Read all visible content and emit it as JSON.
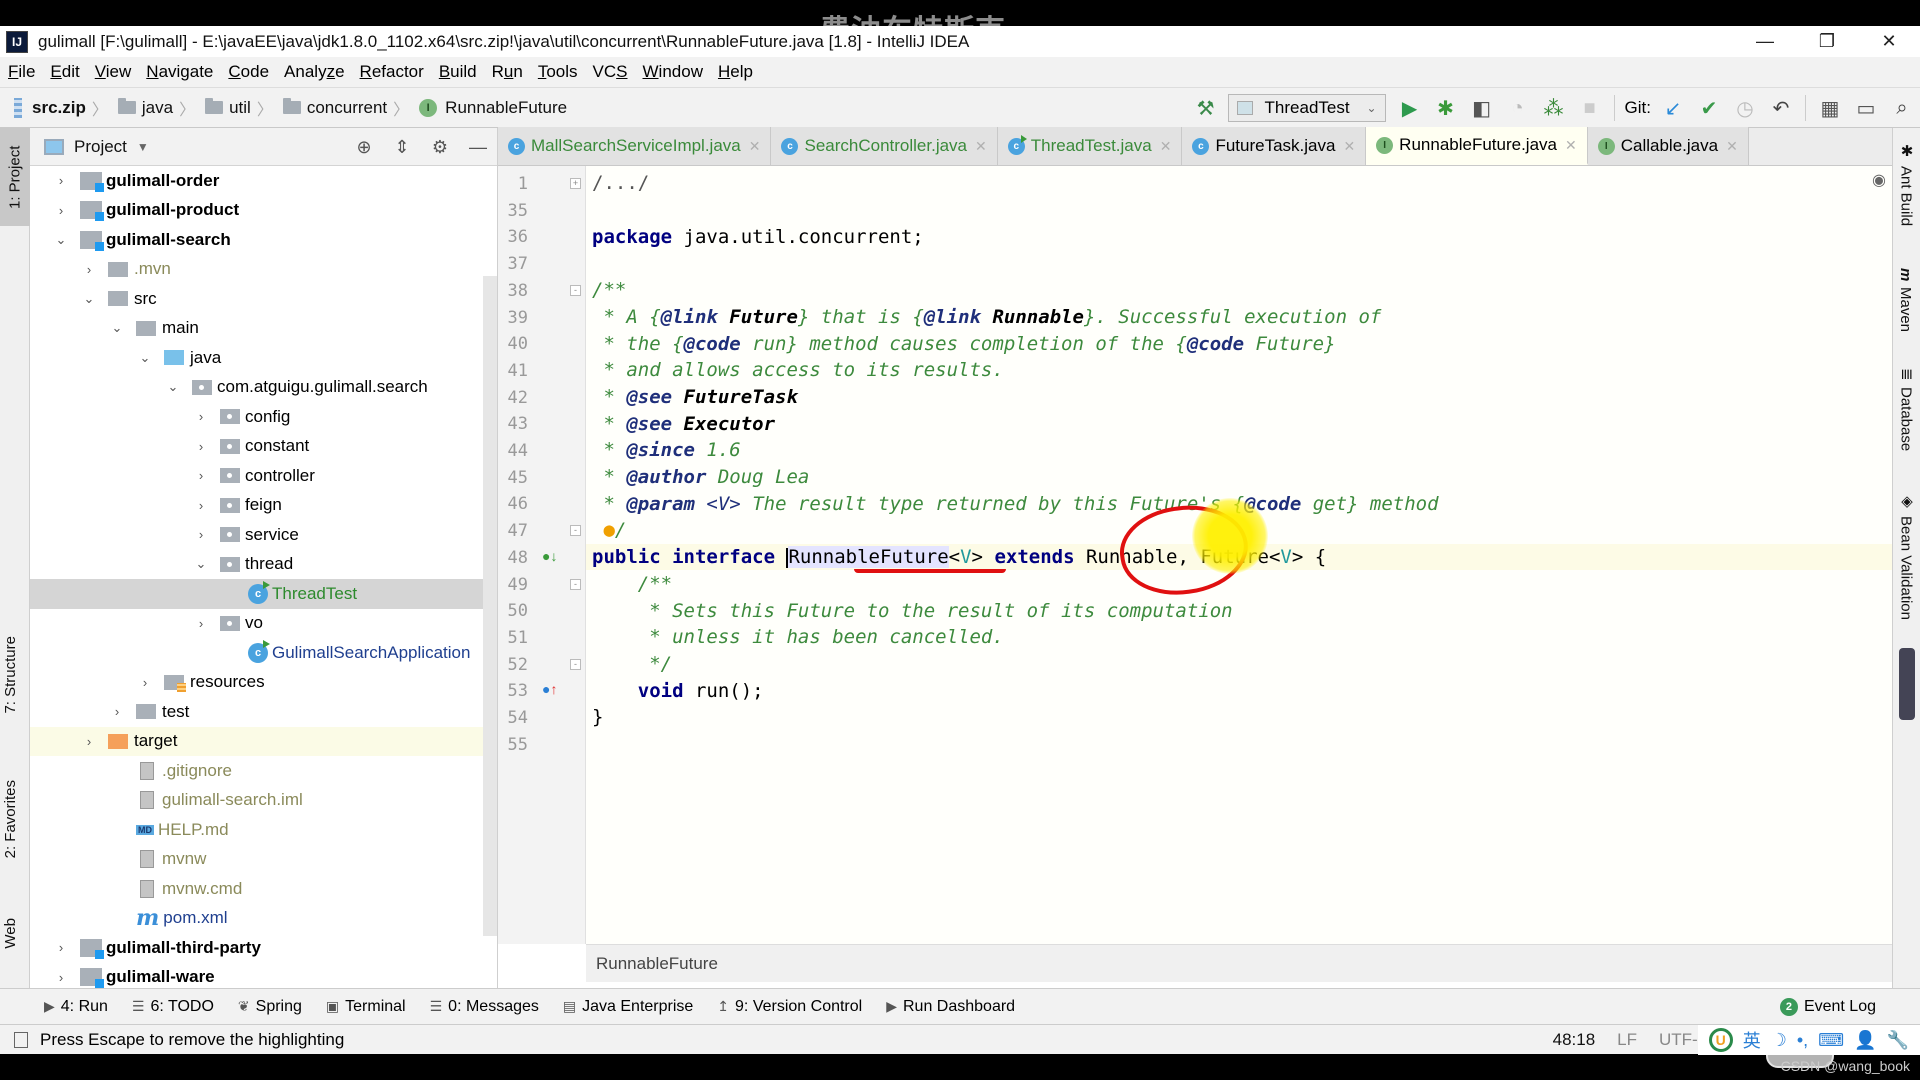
{
  "watermark_top": "费油车特斯克",
  "window": {
    "title": "gulimall [F:\\gulimall] - E:\\javaEE\\java\\jdk1.8.0_1102.x64\\src.zip!\\java\\util\\concurrent\\RunnableFuture.java [1.8] - IntelliJ IDEA",
    "logo": "IJ",
    "minimize": "—",
    "restore": "❐",
    "close": "✕"
  },
  "menu": [
    "File",
    "Edit",
    "View",
    "Navigate",
    "Code",
    "Analyze",
    "Refactor",
    "Build",
    "Run",
    "Tools",
    "VCS",
    "Window",
    "Help"
  ],
  "menu_mnemonics": [
    "F",
    "E",
    "V",
    "N",
    "C",
    "z",
    "R",
    "B",
    "u",
    "T",
    "S",
    "W",
    "H"
  ],
  "navbar": {
    "crumbs": [
      "src.zip",
      "java",
      "util",
      "concurrent",
      "RunnableFuture"
    ],
    "run_config": "ThreadTest",
    "git_label": "Git:"
  },
  "left_strip": {
    "tabs": [
      "1: Project",
      "7: Structure",
      "2: Favorites",
      "Web"
    ]
  },
  "project_panel": {
    "title": "Project",
    "tree": [
      {
        "label": "gulimall-order",
        "type": "module",
        "depth": 0,
        "arrow": "›"
      },
      {
        "label": "gulimall-product",
        "type": "module",
        "depth": 0,
        "arrow": "›"
      },
      {
        "label": "gulimall-search",
        "type": "module",
        "depth": 0,
        "arrow": "⌄"
      },
      {
        "label": ".mvn",
        "type": "folder-muted",
        "depth": 1,
        "arrow": "›"
      },
      {
        "label": "src",
        "type": "folder",
        "depth": 1,
        "arrow": "⌄"
      },
      {
        "label": "main",
        "type": "folder",
        "depth": 2,
        "arrow": "⌄"
      },
      {
        "label": "java",
        "type": "folder-blue",
        "depth": 3,
        "arrow": "⌄"
      },
      {
        "label": "com.atguigu.gulimall.search",
        "type": "package",
        "depth": 4,
        "arrow": "⌄"
      },
      {
        "label": "config",
        "type": "package",
        "depth": 5,
        "arrow": "›"
      },
      {
        "label": "constant",
        "type": "package",
        "depth": 5,
        "arrow": "›"
      },
      {
        "label": "controller",
        "type": "package",
        "depth": 5,
        "arrow": "›"
      },
      {
        "label": "feign",
        "type": "package",
        "depth": 5,
        "arrow": "›"
      },
      {
        "label": "service",
        "type": "package",
        "depth": 5,
        "arrow": "›"
      },
      {
        "label": "thread",
        "type": "package",
        "depth": 5,
        "arrow": "⌄"
      },
      {
        "label": "ThreadTest",
        "type": "class-run",
        "depth": 6,
        "arrow": "",
        "selected": true
      },
      {
        "label": "vo",
        "type": "package",
        "depth": 5,
        "arrow": "›"
      },
      {
        "label": "GulimallSearchApplication",
        "type": "class-app",
        "depth": 6,
        "arrow": ""
      },
      {
        "label": "resources",
        "type": "folder-res",
        "depth": 3,
        "arrow": "›"
      },
      {
        "label": "test",
        "type": "folder",
        "depth": 2,
        "arrow": "›"
      },
      {
        "label": "target",
        "type": "folder-orange",
        "depth": 1,
        "arrow": "›",
        "highlight": true
      },
      {
        "label": ".gitignore",
        "type": "file",
        "depth": 2,
        "arrow": ""
      },
      {
        "label": "gulimall-search.iml",
        "type": "file",
        "depth": 2,
        "arrow": ""
      },
      {
        "label": "HELP.md",
        "type": "md",
        "depth": 2,
        "arrow": ""
      },
      {
        "label": "mvnw",
        "type": "file",
        "depth": 2,
        "arrow": ""
      },
      {
        "label": "mvnw.cmd",
        "type": "file",
        "depth": 2,
        "arrow": ""
      },
      {
        "label": "pom.xml",
        "type": "maven",
        "depth": 2,
        "arrow": ""
      },
      {
        "label": "gulimall-third-party",
        "type": "module",
        "depth": 0,
        "arrow": "›"
      },
      {
        "label": "gulimall-ware",
        "type": "module",
        "depth": 0,
        "arrow": "›"
      }
    ]
  },
  "editor": {
    "tabs": [
      {
        "label": "MallSearchServiceImpl.java",
        "icon": "c",
        "kind": "class",
        "green": true
      },
      {
        "label": "SearchController.java",
        "icon": "c",
        "kind": "class",
        "green": true
      },
      {
        "label": "ThreadTest.java",
        "icon": "c",
        "kind": "class-run",
        "green": true
      },
      {
        "label": "FutureTask.java",
        "icon": "c",
        "kind": "class"
      },
      {
        "label": "RunnableFuture.java",
        "icon": "I",
        "kind": "iface",
        "active": true
      },
      {
        "label": "Callable.java",
        "icon": "I",
        "kind": "iface"
      }
    ],
    "lines": [
      {
        "n": "1",
        "html": "<span class=\"cm\" style=\"font-style:normal;color:#555\">/.../</span>"
      },
      {
        "n": "35",
        "html": ""
      },
      {
        "n": "36",
        "html": "<span class=\"kw\">package</span> java.util.concurrent;"
      },
      {
        "n": "37",
        "html": ""
      },
      {
        "n": "38",
        "html": "<span class=\"cm\">/**</span>"
      },
      {
        "n": "39",
        "html": "<span class=\"cm\"> * A {<span class=\"tag\">@link</span> <span class=\"tagref\">Future</span>} that is {<span class=\"tag\">@link</span> <span class=\"tagref\">Runnable</span>}. Successful execution of</span>"
      },
      {
        "n": "40",
        "html": "<span class=\"cm\"> * the {<span class=\"tag\">@code</span> run} method causes completion of the {<span class=\"tag\">@code</span> Future}</span>"
      },
      {
        "n": "41",
        "html": "<span class=\"cm\"> * and allows access to its results.</span>"
      },
      {
        "n": "42",
        "html": "<span class=\"cm\"> * <span class=\"tag\">@see</span> <span class=\"tagref\">FutureTask</span></span>"
      },
      {
        "n": "43",
        "html": "<span class=\"cm\"> * <span class=\"tag\">@see</span> <span class=\"tagref\">Executor</span></span>"
      },
      {
        "n": "44",
        "html": "<span class=\"cm\"> * <span class=\"tag\">@since</span> 1.6</span>"
      },
      {
        "n": "45",
        "html": "<span class=\"cm\"> * <span class=\"tag\">@author</span> Doug Lea</span>"
      },
      {
        "n": "46",
        "html": "<span class=\"cm\"> * <span class=\"tag\">@param</span> <span style=\"color:#1f2f7a\">&lt;V&gt;</span> The result type returned by this Future's {<span class=\"tag\">@code</span> get} method</span>"
      },
      {
        "n": "47",
        "html": "<span class=\"cm\"> <span style=\"color:#f0a000\">●</span>/</span>"
      },
      {
        "n": "48",
        "html": "<span class=\"kw\">public interface</span> <span class=\"caret-line\"></span><span class=\"sel-word\">RunnableFuture</span>&lt;<span class=\"tp\">V</span>&gt; <span class=\"kw\">extends</span> Runnable, Future&lt;<span class=\"tp\">V</span>&gt; {",
        "current": true
      },
      {
        "n": "49",
        "html": "    <span class=\"cm\">/**</span>"
      },
      {
        "n": "50",
        "html": "<span class=\"cm\">     * Sets this Future to the result of its computation</span>"
      },
      {
        "n": "51",
        "html": "<span class=\"cm\">     * unless it has been cancelled.</span>"
      },
      {
        "n": "52",
        "html": "<span class=\"cm\">     */</span>"
      },
      {
        "n": "53",
        "html": "    <span class=\"kw\">void</span> run();"
      },
      {
        "n": "54",
        "html": "}"
      },
      {
        "n": "55",
        "html": ""
      }
    ],
    "breadcrumb": "RunnableFuture"
  },
  "right_strip": {
    "tabs": [
      "Ant Build",
      "Maven",
      "Database",
      "Bean Validation"
    ]
  },
  "bottom_tools": {
    "items": [
      {
        "label": "4: Run",
        "icon": "▶"
      },
      {
        "label": "6: TODO",
        "icon": "☰"
      },
      {
        "label": "Spring",
        "icon": "❦"
      },
      {
        "label": "Terminal",
        "icon": "▣"
      },
      {
        "label": "0: Messages",
        "icon": "☰"
      },
      {
        "label": "Java Enterprise",
        "icon": "▤"
      },
      {
        "label": "9: Version Control",
        "icon": "↥"
      },
      {
        "label": "Run Dashboard",
        "icon": "▶"
      }
    ],
    "event_log": "Event Log",
    "event_count": "2"
  },
  "status": {
    "message": "Press Escape to remove the highlighting",
    "position": "48:18",
    "line_sep": "LF",
    "encoding": "UTF-",
    "ime_lang": "英"
  },
  "csdn": "CSDN @wang_book"
}
